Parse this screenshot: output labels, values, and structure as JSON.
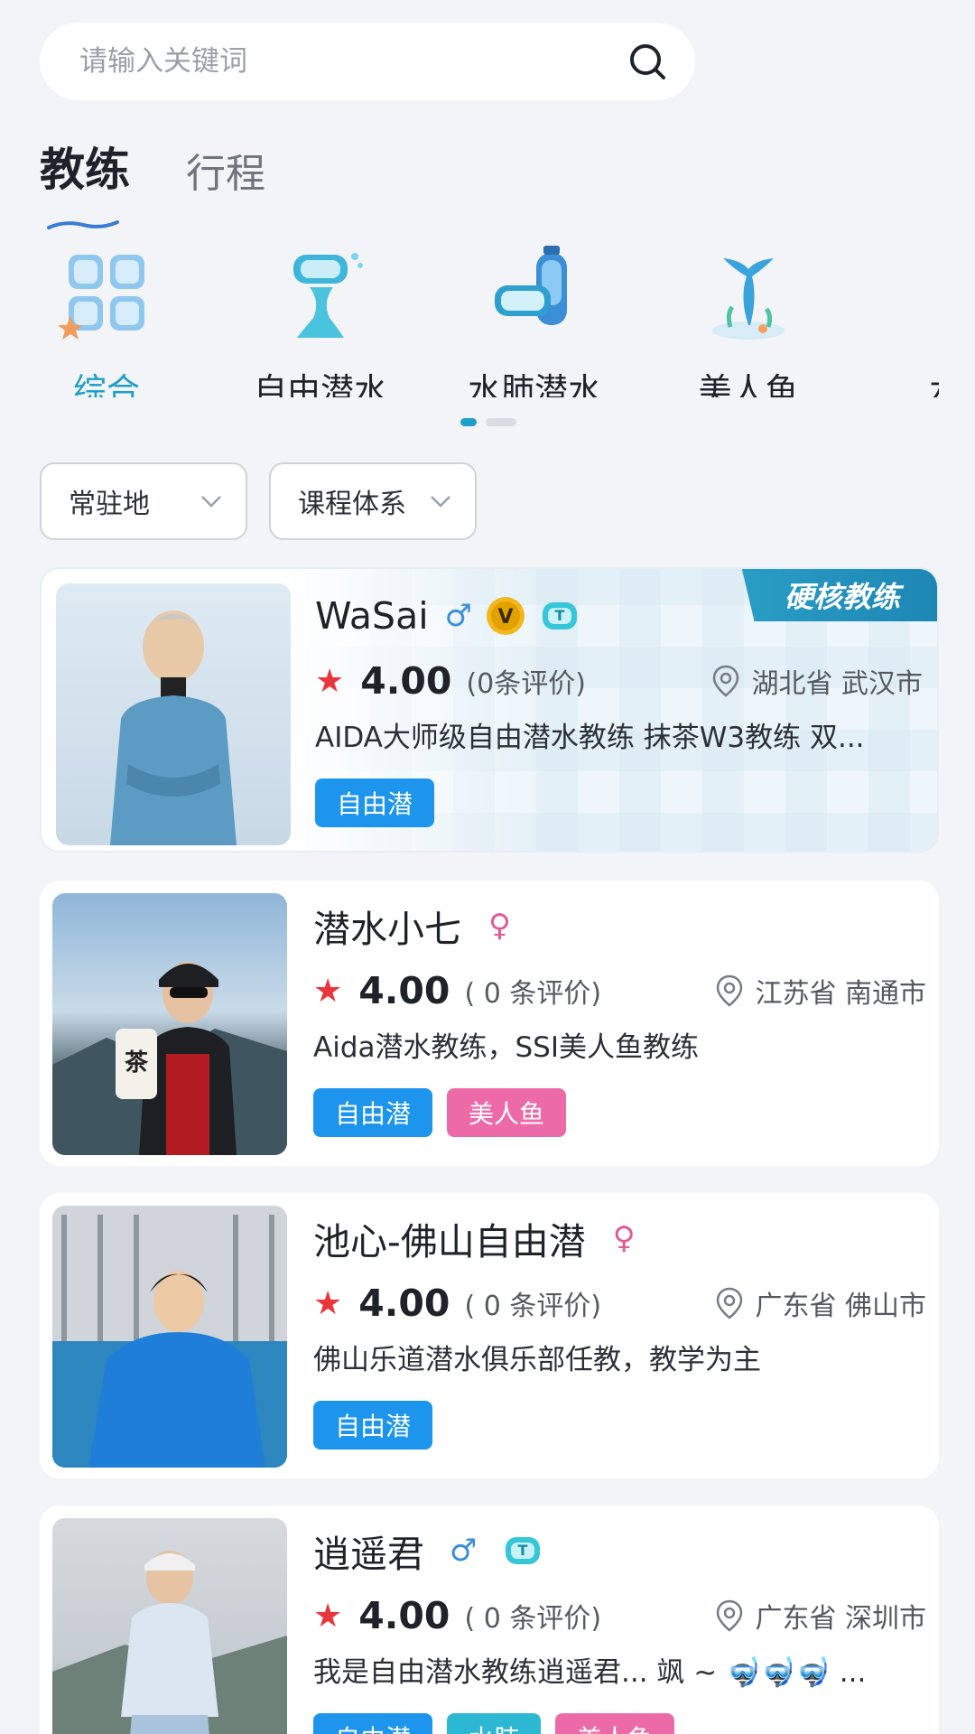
{
  "search": {
    "placeholder": "请输入关键词"
  },
  "tabs": [
    {
      "label": "教练"
    },
    {
      "label": "行程"
    }
  ],
  "categories": [
    {
      "label": "综合",
      "icon": "grid-apps-icon",
      "active": true
    },
    {
      "label": "自由潜水",
      "icon": "mask-fin-icon"
    },
    {
      "label": "水肺潜水",
      "icon": "scuba-mask-icon"
    },
    {
      "label": "美人鱼",
      "icon": "mermaid-tail-icon"
    },
    {
      "label": "水下",
      "icon": "underwater-icon"
    }
  ],
  "filters": [
    {
      "label": "常驻地"
    },
    {
      "label": "课程体系"
    }
  ],
  "colors": {
    "accent": "#1d9fc7",
    "star": "#e8363c",
    "tag_blue": "#1d95ec",
    "tag_pink": "#ec6aa7",
    "tag_teal": "#2cb7d3"
  },
  "coaches": [
    {
      "name": "WaSai",
      "gender": "♂",
      "badges": [
        "v-badge-icon",
        "t-badge-icon"
      ],
      "score": "4.00",
      "reviews": "(0条评价)",
      "location": "湖北省 武汉市",
      "desc": "AIDA大师级自由潜水教练 抹茶W3教练 双...",
      "tags": [
        "自由潜"
      ],
      "ribbon": "硬核教练"
    },
    {
      "name": "潜水小七",
      "gender": "♀",
      "badges": [],
      "score": "4.00",
      "reviews": "( 0 条评价)",
      "location": "江苏省 南通市",
      "desc": "Aida潜水教练，SSI美人鱼教练",
      "tags": [
        "自由潜",
        "美人鱼"
      ]
    },
    {
      "name": "池心-佛山自由潜",
      "gender": "♀",
      "badges": [],
      "score": "4.00",
      "reviews": "( 0 条评价)",
      "location": "广东省 佛山市",
      "desc": "佛山乐道潜水俱乐部任教，教学为主",
      "tags": [
        "自由潜"
      ]
    },
    {
      "name": "逍遥君",
      "gender": "♂",
      "badges": [
        "t-badge-icon"
      ],
      "score": "4.00",
      "reviews": "( 0 条评价)",
      "location": "广东省 深圳市",
      "desc": "我是自由潜水教练逍遥君... 飒 ~ 🤿🤿🤿 ...",
      "tags": [
        "自由潜",
        "水肺",
        "美人鱼"
      ]
    }
  ]
}
